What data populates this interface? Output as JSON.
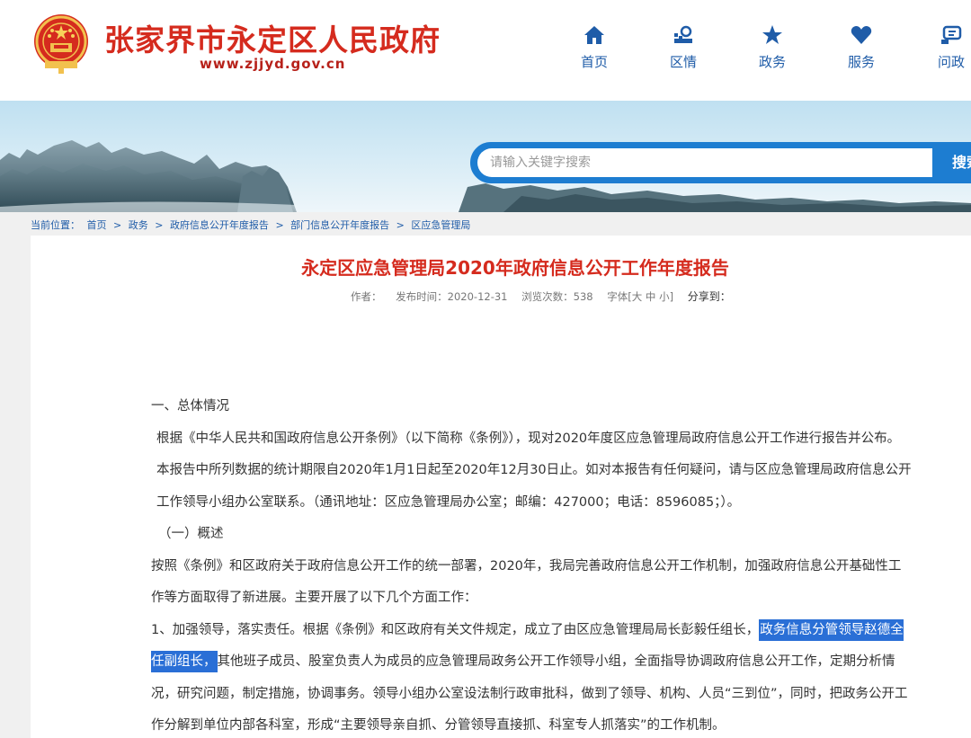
{
  "header": {
    "site_title": "张家界市永定区人民政府",
    "site_url": "www.zjjyd.gov.cn",
    "nav": [
      {
        "label": "首页",
        "icon": "home-icon"
      },
      {
        "label": "区情",
        "icon": "district-icon"
      },
      {
        "label": "政务",
        "icon": "star-icon"
      },
      {
        "label": "服务",
        "icon": "heart-icon"
      },
      {
        "label": "问政",
        "icon": "chat-icon"
      }
    ],
    "accent_color": "#1f5ca8",
    "brand_color": "#d52b1e"
  },
  "search": {
    "placeholder": "请输入关键字搜索",
    "button_label": "搜索"
  },
  "breadcrumb": {
    "prefix": "当前位置：",
    "items": [
      "首页",
      "政务",
      "政府信息公开年度报告",
      "部门信息公开年度报告",
      "区应急管理局"
    ],
    "separator": ">"
  },
  "article": {
    "title": "永定区应急管理局2020年政府信息公开工作年度报告",
    "meta": {
      "author": "作者：",
      "date": "发布时间：2020-12-31",
      "views": "浏览次数：538",
      "font_size": "字体[大 中 小]",
      "share": "分享到："
    },
    "section1_heading": "一、总体情况",
    "para1": "根据《中华人民共和国政府信息公开条例》（以下简称《条例》），现对2020年度区应急管理局政府信息公开工作进行报告并公布。本报告中所列数据的统计期限自2020年1月1日起至2020年12月30日止。如对本报告有任何疑问，请与区应急管理局政府信息公开工作领导小组办公室联系。（通讯地址：区应急管理局办公室；邮编：427000；电话：8596085；）。",
    "sub1_heading": "（一）概述",
    "para2": "按照《条例》和区政府关于政府信息公开工作的统一部署，2020年，我局完善政府信息公开工作机制，加强政府信息公开基础性工作等方面取得了新进展。主要开展了以下几个方面工作：",
    "para3_before": "1、加强领导，落实责任。根据《条例》和区政府有关文件规定，成立了由区应急管理局局长彭毅任组长，",
    "para3_highlight": "政务信息分管领导赵德全任副组长，",
    "para3_after": "其他班子成员、股室负责人为成员的应急管理局政务公开工作领导小组，全面指导协调政府信息公开工作，定期分析情况，研究问题，制定措施，协调事务。领导小组办公室设法制行政审批科，做到了领导、机构、人员“三到位”，同时，把政务公开工作分解到单位内部各科室，形成“主要领导亲自抓、分管领导直接抓、科室专人抓落实”的工作机制。",
    "highlight_color": "#2a6fd6"
  }
}
